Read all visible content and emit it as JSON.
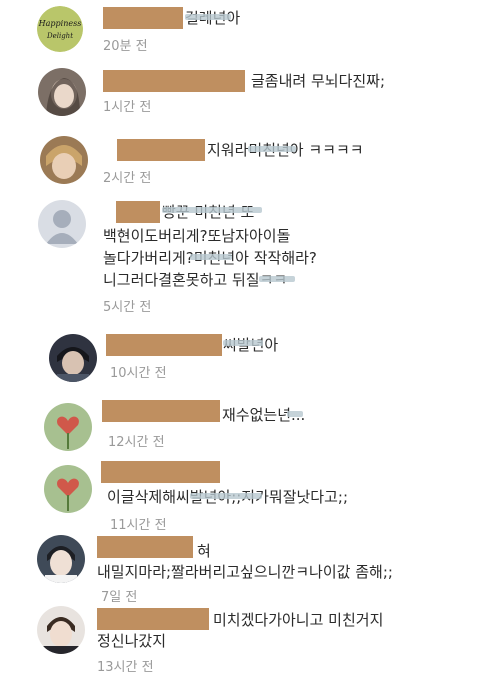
{
  "comments": [
    {
      "text": "걸레년아",
      "time": "20분 전"
    },
    {
      "text": "글좀내려 무뇌다진짜;",
      "time": "1시간 전"
    },
    {
      "text": "지워라미친년아 ㅋㅋㅋㅋ",
      "time": "2시간 전"
    },
    {
      "lines": [
        "빵꾼 미친년 또",
        "백현이도버리게?또남자아이돌",
        "놀다가버리게?미친년아 작작해라?",
        "니그러다결혼못하고 뒤질ㅋㅋ"
      ],
      "time": "5시간 전"
    },
    {
      "text": "씨발년아",
      "time": "10시간 전"
    },
    {
      "text": "재수없는년...",
      "time": "12시간 전"
    },
    {
      "text": "이글삭제해씨발년아;;지가뭐잘낫다고;;",
      "time": "11시간 전"
    },
    {
      "lines": [
        "혀",
        "내밀지마라;짤라버리고싶으니깐ㅋ나이값 좀해;;"
      ],
      "time": "7일 전"
    },
    {
      "lines": [
        "미치겠다가아니고 미친거지",
        "정신나갔지"
      ],
      "time": "13시간 전"
    }
  ],
  "colors": {
    "name_redaction": "#bf8f60",
    "time": "#9a9a9a",
    "text": "#2b2b2b"
  },
  "avatars": [
    "happiness-lettering-icon",
    "girl-photo",
    "boy-photo",
    "default-user-icon",
    "boy-photo",
    "flower-heart-photo",
    "flower-heart-photo",
    "boy-photo",
    "boy-photo"
  ]
}
